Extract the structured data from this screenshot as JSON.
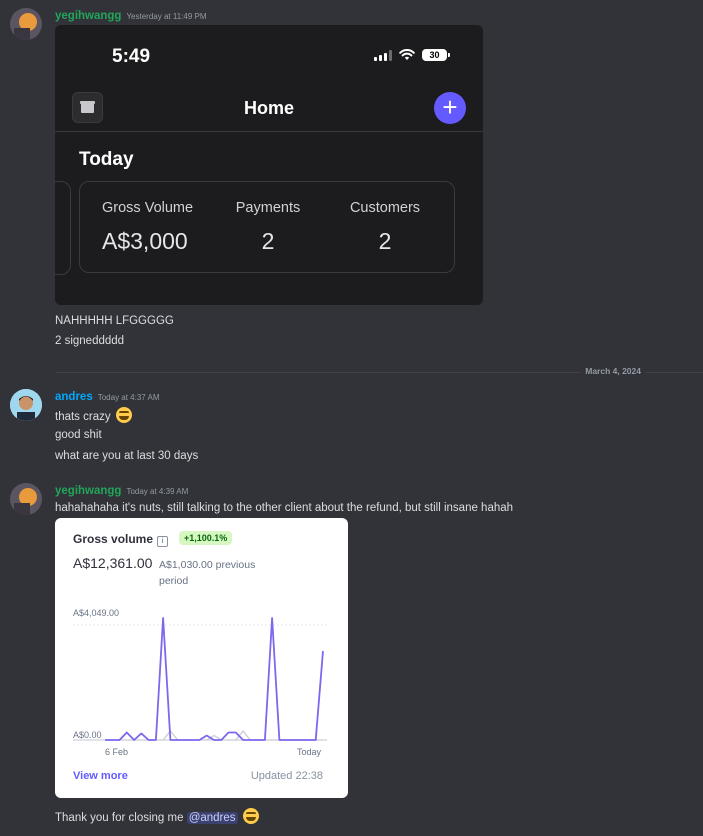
{
  "messages": {
    "m1": {
      "author": "yegihwangg",
      "timestamp": "Yesterday at 11:49 PM",
      "author_color": "#23a55a",
      "line1": "NAHHHHH LFGGGGG",
      "line2": "2 signeddddd"
    },
    "m2": {
      "author": "andres",
      "timestamp": "Today at 4:37 AM",
      "author_color": "#00a8fc",
      "line1": "thats crazy",
      "line2": "good shit",
      "line3": "what are you at last 30 days"
    },
    "m3": {
      "author": "yegihwangg",
      "timestamp": "Today at 4:39 AM",
      "author_color": "#23a55a",
      "line1": "hahahahaha it's nuts, still talking to the other client about the refund, but still insane hahah",
      "line2_prefix": "Thank you for closing me",
      "mention": "@andres"
    }
  },
  "date_divider": "March 4, 2024",
  "phone": {
    "time": "5:49",
    "battery": "30",
    "title": "Home",
    "section": "Today",
    "stats": [
      {
        "label": "Gross Volume",
        "value": "A$3,000"
      },
      {
        "label": "Payments",
        "value": "2"
      },
      {
        "label": "Customers",
        "value": "2"
      }
    ]
  },
  "gross_card": {
    "title": "Gross volume",
    "change": "+1,100.1%",
    "value": "A$12,361.00",
    "previous": "A$1,030.00 previous period",
    "y_max_label": "A$4,049.00",
    "y_min_label": "A$0.00",
    "x_start_label": "6 Feb",
    "x_end_label": "Today",
    "view_more": "View more",
    "updated": "Updated 22:38"
  },
  "chart_data": {
    "type": "line",
    "title": "Gross volume",
    "x_start": "6 Feb",
    "x_end": "Today",
    "ylim": [
      0,
      4049
    ],
    "series": [
      {
        "values": [
          0,
          0,
          0,
          250,
          0,
          220,
          0,
          0,
          4049,
          0,
          0,
          0,
          0,
          0,
          150,
          0,
          0,
          250,
          250,
          0,
          0,
          0,
          0,
          4049,
          0,
          0,
          0,
          0,
          0,
          0,
          2950
        ],
        "color": "#7b68ee"
      },
      {
        "values": [
          0,
          0,
          0,
          0,
          0,
          0,
          0,
          0,
          0,
          300,
          0,
          0,
          0,
          0,
          0,
          150,
          0,
          0,
          0,
          300,
          0,
          0,
          0,
          0,
          0,
          0,
          0,
          0,
          0,
          0,
          0
        ],
        "color": "#c7ccd4"
      }
    ]
  }
}
